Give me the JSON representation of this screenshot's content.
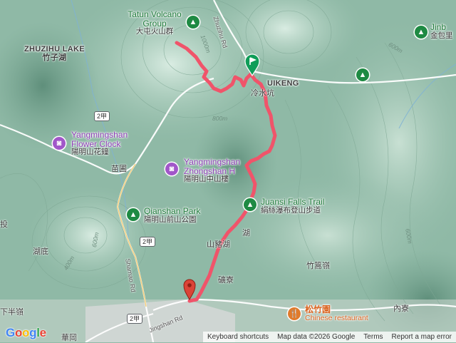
{
  "map": {
    "places": {
      "tatun_en_1": "Tatun Volcano",
      "tatun_en_2": "Group",
      "tatun_zh": "大屯火山群",
      "zhuzihu_en": "ZHUZIHU LAKE",
      "zhuzihu_zh": "竹子湖",
      "lengshuikeng": "UIKENG",
      "lengshuikeng_zh": "冷水坑",
      "miaopu": "苗圃",
      "shanzhuhu": "山豬湖",
      "shanzhuhu2": "湖",
      "kuangliao": "礦寮",
      "zhuzaishan": "竹篙嶺",
      "neiliao": "內寮",
      "hudi": "湖底",
      "tou": "投",
      "xiabanling": "下半嶺",
      "huagang": "華岡",
      "jinbao_en": "Jinb",
      "jinbao_zh": "金包里"
    },
    "pois": {
      "flower_clock_en_1": "Yangmingshan",
      "flower_clock_en_2": "Flower Clock",
      "flower_clock_zh": "陽明山花鐘",
      "zhongshan_en_1": "Yangmingshan",
      "zhongshan_en_2": "Zhongshan H",
      "zhongshan_zh": "陽明山中山樓",
      "juansi_en": "Juansi Falls Trail",
      "juansi_zh": "絹絲瀑布登山步道",
      "qianshan_en": "Qianshan Park",
      "qianshan_zh": "陽明山前山公園",
      "restaurant_zh": "松竹園",
      "restaurant_en": "Chinese restaurant"
    },
    "roads": {
      "zhuzihu_rd": "Zhuzihu Rd",
      "jingshan_rd": "Jingshan Rd",
      "shamao_rd": "Shamao Rd",
      "route_2a_1": "2甲",
      "route_2a_2": "2甲",
      "route_2a_3": "2甲"
    },
    "contours": {
      "c1000": "1000m",
      "c800": "800m",
      "c600": "600m",
      "c600b": "600m",
      "c400": "400m",
      "c600c": "600m"
    },
    "colors": {
      "route": "#f0546a",
      "start_marker": "#0f9d58",
      "end_marker": "#db4437"
    }
  },
  "footer": {
    "logo": "Google",
    "shortcuts": "Keyboard shortcuts",
    "map_data": "Map data ©2026 Google",
    "terms": "Terms",
    "report": "Report a map error"
  }
}
